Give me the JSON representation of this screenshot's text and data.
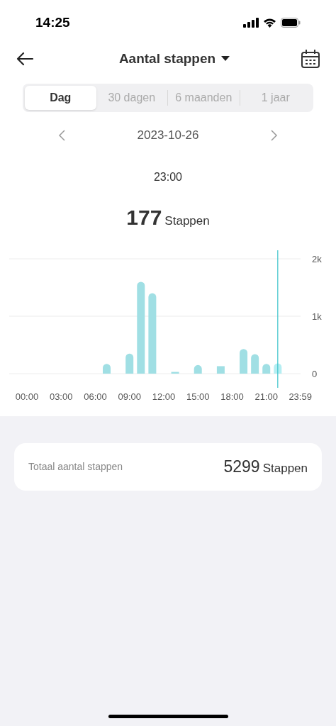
{
  "status_bar": {
    "time": "14:25"
  },
  "header": {
    "title": "Aantal stappen"
  },
  "tabs": [
    {
      "label": "Dag",
      "selected": true
    },
    {
      "label": "30 dagen",
      "selected": false
    },
    {
      "label": "6 maanden",
      "selected": false
    },
    {
      "label": "1 jaar",
      "selected": false
    }
  ],
  "date_nav": {
    "date": "2023-10-26"
  },
  "readout": {
    "time": "23:00",
    "value": "177",
    "unit": "Stappen"
  },
  "chart_data": {
    "type": "bar",
    "x": [
      0,
      1,
      2,
      3,
      4,
      5,
      6,
      7,
      8,
      9,
      10,
      11,
      12,
      13,
      14,
      15,
      16,
      17,
      18,
      19,
      20,
      21,
      22,
      23
    ],
    "values": [
      0,
      0,
      0,
      0,
      0,
      0,
      0,
      170,
      0,
      350,
      1600,
      1400,
      0,
      30,
      0,
      150,
      0,
      130,
      0,
      430,
      340,
      170,
      180,
      0
    ],
    "xlim": [
      -1.55,
      24
    ],
    "ylim": [
      0,
      2000
    ],
    "xticks": [
      {
        "value": 0,
        "label": "00:00"
      },
      {
        "value": 3,
        "label": "03:00"
      },
      {
        "value": 6,
        "label": "06:00"
      },
      {
        "value": 9,
        "label": "09:00"
      },
      {
        "value": 12,
        "label": "12:00"
      },
      {
        "value": 15,
        "label": "15:00"
      },
      {
        "value": 18,
        "label": "18:00"
      },
      {
        "value": 21,
        "label": "21:00"
      },
      {
        "value": 23.98,
        "label": "23:59"
      }
    ],
    "yticks": [
      {
        "value": 0,
        "label": "0"
      },
      {
        "value": 1000,
        "label": "1k"
      },
      {
        "value": 2000,
        "label": "2k"
      }
    ],
    "ref_lines": [
      {
        "axis": "x",
        "value": 22
      }
    ]
  },
  "summary": {
    "label": "Totaal aantal stappen",
    "value": "5299",
    "unit": "Stappen"
  }
}
